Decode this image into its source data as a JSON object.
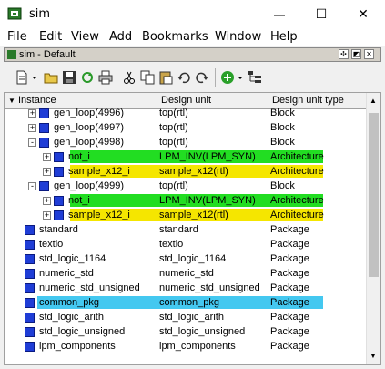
{
  "window": {
    "title": "sim",
    "controls": {
      "minimize": "—",
      "maximize": "☐",
      "close": "✕"
    }
  },
  "menu": [
    "File",
    "Edit",
    "View",
    "Add",
    "Bookmarks",
    "Window",
    "Help"
  ],
  "subwindow": {
    "title": "sim - Default"
  },
  "toolbar": {
    "icons": [
      "new-icon",
      "open-icon",
      "save-icon",
      "reload-icon",
      "print-icon",
      "cut-icon",
      "copy-icon",
      "paste-icon",
      "undo-icon",
      "redo-icon",
      "add-icon",
      "hierarchy-icon"
    ]
  },
  "columns": [
    "Instance",
    "Design unit",
    "Design unit type"
  ],
  "rows": [
    {
      "name": "gen_loop(4996)",
      "unit": "top(rtl)",
      "type": "Block",
      "expander": "+",
      "highlight": ""
    },
    {
      "name": "gen_loop(4997)",
      "unit": "top(rtl)",
      "type": "Block",
      "expander": "+",
      "highlight": ""
    },
    {
      "name": "gen_loop(4998)",
      "unit": "top(rtl)",
      "type": "Block",
      "expander": "-",
      "highlight": ""
    },
    {
      "name": "not_i",
      "unit": "LPM_INV(LPM_SYN)",
      "type": "Architecture",
      "expander": "+",
      "highlight": "#22dd22"
    },
    {
      "name": "sample_x12_i",
      "unit": "sample_x12(rtl)",
      "type": "Architecture",
      "expander": "+",
      "highlight": "#f5e600"
    },
    {
      "name": "gen_loop(4999)",
      "unit": "top(rtl)",
      "type": "Block",
      "expander": "-",
      "highlight": ""
    },
    {
      "name": "not_i",
      "unit": "LPM_INV(LPM_SYN)",
      "type": "Architecture",
      "expander": "+",
      "highlight": "#22dd22"
    },
    {
      "name": "sample_x12_i",
      "unit": "sample_x12(rtl)",
      "type": "Architecture",
      "expander": "+",
      "highlight": "#f5e600"
    },
    {
      "name": "standard",
      "unit": "standard",
      "type": "Package",
      "expander": "",
      "highlight": ""
    },
    {
      "name": "textio",
      "unit": "textio",
      "type": "Package",
      "expander": "",
      "highlight": ""
    },
    {
      "name": "std_logic_1164",
      "unit": "std_logic_1164",
      "type": "Package",
      "expander": "",
      "highlight": ""
    },
    {
      "name": "numeric_std",
      "unit": "numeric_std",
      "type": "Package",
      "expander": "",
      "highlight": ""
    },
    {
      "name": "numeric_std_unsigned",
      "unit": "numeric_std_unsigned",
      "type": "Package",
      "expander": "",
      "highlight": ""
    },
    {
      "name": "common_pkg",
      "unit": "common_pkg",
      "type": "Package",
      "expander": "",
      "highlight": "#44c8f0"
    },
    {
      "name": "std_logic_arith",
      "unit": "std_logic_arith",
      "type": "Package",
      "expander": "",
      "highlight": ""
    },
    {
      "name": "std_logic_unsigned",
      "unit": "std_logic_unsigned",
      "type": "Package",
      "expander": "",
      "highlight": ""
    },
    {
      "name": "lpm_components",
      "unit": "lpm_components",
      "type": "Package",
      "expander": "",
      "highlight": ""
    }
  ]
}
